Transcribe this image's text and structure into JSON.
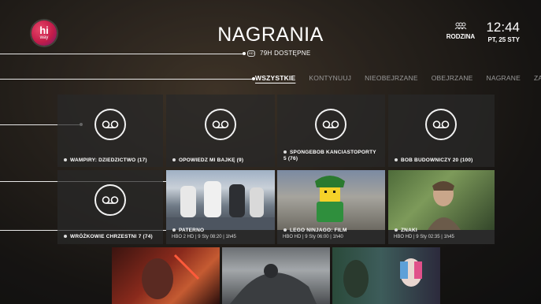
{
  "header": {
    "logo_line1": "hi",
    "logo_line2": "way",
    "title": "NAGRANIA",
    "hours_icon": "hd-icon",
    "hours_available": "79H DOSTĘPNE",
    "profile_icon": "family-icon",
    "profile_label": "RODZINA",
    "time": "12:44",
    "date": "PT, 25 STY"
  },
  "tabs": [
    {
      "label": "WSZYSTKIE",
      "active": true
    },
    {
      "label": "KONTYNUUJ",
      "active": false
    },
    {
      "label": "NIEOBEJRZANE",
      "active": false
    },
    {
      "label": "OBEJRZANE",
      "active": false
    },
    {
      "label": "NAGRANE",
      "active": false
    },
    {
      "label": "ZAP",
      "active": false
    }
  ],
  "recordings": [
    {
      "title": "WAMPIRY: DZIEDZICTWO (17)",
      "icon": "recording-icon"
    },
    {
      "title": "OPOWIEDZ MI BAJKĘ (9)",
      "icon": "recording-icon"
    },
    {
      "title": "SPONGEBOB KANCIASTOPORTY 5 (76)",
      "icon": "recording-icon"
    },
    {
      "title": "BOB BUDOWNICZY 20 (100)",
      "icon": "recording-icon"
    },
    {
      "title": "WRÓŻKOWIE CHRZESTNI 7 (74)",
      "icon": "recording-icon"
    },
    {
      "title": "PATERNO",
      "meta": "HBO 2 HD | 9 Sty 08:20 | 1h45"
    },
    {
      "title": "LEGO NINJAGO: FILM",
      "meta": "HBO HD | 9 Sty 06:00 | 1h40"
    },
    {
      "title": "ZNAKI",
      "meta": "HBO HD | 9 Sty 02:35 | 1h45"
    }
  ],
  "colors": {
    "accent": "#c31c49",
    "tile_bg": "#2b2b2b",
    "text": "#ffffff",
    "muted": "#9a9a9a"
  }
}
